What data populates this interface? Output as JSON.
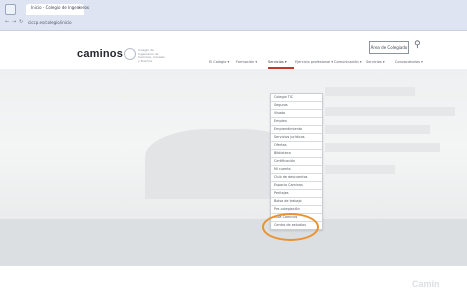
{
  "browser": {
    "tab_title": "Inicio - Colegio de Ingenieros",
    "tab_close": "×",
    "back_icon": "arrow-left-icon",
    "forward_icon": "arrow-right-icon",
    "reload_icon": "reload-icon",
    "url": "ciccp.es/colegio/inicio"
  },
  "header": {
    "logo_text": "caminos",
    "logo_tagline": "Colegio de Ingenieros de Caminos, Canales y Puertos",
    "colegiado_button": "Área de Colegiado",
    "search_icon": "search-icon"
  },
  "nav": {
    "items": [
      "El Colegio ▾",
      "Formación ▾",
      "Servicios ▾",
      "Ejercicio profesional ▾",
      "Comunicación ▾",
      "Servicios ▾",
      "Convocatorias ▾"
    ],
    "active_index": 2
  },
  "dropdown": {
    "items": [
      "Colegio TIC",
      "Seguros",
      "Visado",
      "Empleo",
      "Emprendimiento",
      "Servicios jurídicos",
      "Ofertas",
      "Biblioteca",
      "Certificación",
      "Mi cuenta",
      "Club de descuentos",
      "Espacio Caminos",
      "Peritajes",
      "Bolsa de trabajo",
      "Pre-colegiación",
      "Aula Caminos",
      "Centro de estudios"
    ],
    "highlighted_index": 12
  },
  "hero": {
    "word": "Camin"
  },
  "colors": {
    "accent": "#c0392b",
    "highlight_ring": "#e9922f"
  }
}
